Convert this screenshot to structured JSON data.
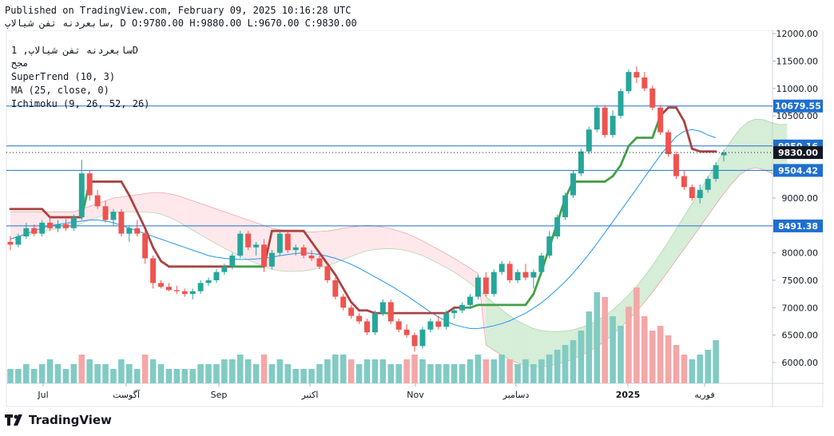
{
  "header": {
    "published": "Published on TradingView.com, February 09, 2025 10:16:28 UTC",
    "ohlc_line": "سابعردنه تفن شيالاپ, D O:9780.00 H:9880.00 L:9670.00 C:9830.00"
  },
  "legend": {
    "symbol": "سابعردنه تفن شيالاپ, 1D",
    "exchange": "مجح",
    "supertrend": "SuperTrend (10, 3)",
    "ma": "MA (25, close, 0)",
    "ichimoku": "Ichimoku (9, 26, 52, 26)"
  },
  "brand": {
    "name": "TradingView"
  },
  "colors": {
    "up": "#26a69a",
    "down": "#ef5350",
    "supertrend_up": "#43a047",
    "supertrend_down": "#a94442",
    "ma": "#2196f3",
    "hline": "#1e6fd0",
    "cloud_green": "#a5d6a7",
    "cloud_red": "#ffcdd2",
    "vol_up": "#80cbc4",
    "vol_down": "#f4a7a7",
    "current_price_bg": "#131722"
  },
  "chart_data": {
    "type": "candlestick",
    "ylim": [
      5620,
      12060
    ],
    "y_ticks": [
      "12000.00",
      "11500.00",
      "11000.00",
      "10500.00",
      "10000.00",
      "9500.00",
      "9000.00",
      "8500.00",
      "8000.00",
      "7500.00",
      "7000.00",
      "6500.00",
      "6000.00"
    ],
    "x_ticks": [
      "Jul",
      "آگوست",
      "Sep",
      "اکتبر",
      "Nov",
      "دسامبر",
      "2025",
      "فوریه"
    ],
    "horizontal_levels": [
      {
        "value": 10679.55,
        "label": "10679.55"
      },
      {
        "value": 9950.16,
        "label": "9950.16"
      },
      {
        "value": 9504.42,
        "label": "9504.42"
      },
      {
        "value": 8491.38,
        "label": "8491.38"
      }
    ],
    "current_price": {
      "value": 9830.0,
      "label": "9830.00"
    },
    "candles": [
      [
        8200,
        8300,
        8050,
        8150
      ],
      [
        8150,
        8350,
        8100,
        8300
      ],
      [
        8300,
        8550,
        8250,
        8450
      ],
      [
        8450,
        8520,
        8300,
        8350
      ],
      [
        8350,
        8600,
        8300,
        8550
      ],
      [
        8550,
        8650,
        8400,
        8450
      ],
      [
        8450,
        8600,
        8380,
        8520
      ],
      [
        8520,
        8620,
        8400,
        8450
      ],
      [
        8450,
        8700,
        8400,
        8650
      ],
      [
        8650,
        9700,
        8600,
        9450
      ],
      [
        9450,
        9500,
        8950,
        9050
      ],
      [
        9050,
        9150,
        8800,
        8850
      ],
      [
        8850,
        8950,
        8550,
        8600
      ],
      [
        8600,
        8800,
        8500,
        8750
      ],
      [
        8750,
        8800,
        8300,
        8350
      ],
      [
        8350,
        8500,
        8200,
        8450
      ],
      [
        8450,
        8600,
        8300,
        8350
      ],
      [
        8350,
        8400,
        7800,
        7900
      ],
      [
        7900,
        7950,
        7350,
        7450
      ],
      [
        7450,
        7500,
        7350,
        7380
      ],
      [
        7380,
        7450,
        7300,
        7320
      ],
      [
        7320,
        7400,
        7250,
        7300
      ],
      [
        7300,
        7350,
        7200,
        7250
      ],
      [
        7250,
        7350,
        7150,
        7300
      ],
      [
        7300,
        7500,
        7250,
        7450
      ],
      [
        7450,
        7550,
        7400,
        7500
      ],
      [
        7500,
        7700,
        7450,
        7650
      ],
      [
        7650,
        7800,
        7600,
        7750
      ],
      [
        7750,
        8000,
        7700,
        7950
      ],
      [
        7950,
        8400,
        7900,
        8350
      ],
      [
        8350,
        8400,
        8050,
        8100
      ],
      [
        8100,
        8200,
        7950,
        8150
      ],
      [
        8150,
        8250,
        7650,
        7750
      ],
      [
        7750,
        8050,
        7700,
        8000
      ],
      [
        8000,
        8400,
        7950,
        8350
      ],
      [
        8350,
        8400,
        8000,
        8050
      ],
      [
        8050,
        8150,
        7950,
        8100
      ],
      [
        8100,
        8150,
        7900,
        7950
      ],
      [
        7950,
        8050,
        7850,
        7900
      ],
      [
        7900,
        7950,
        7700,
        7750
      ],
      [
        7750,
        7800,
        7450,
        7500
      ],
      [
        7500,
        7550,
        7150,
        7200
      ],
      [
        7200,
        7250,
        6950,
        7000
      ],
      [
        7000,
        7050,
        6800,
        6850
      ],
      [
        6850,
        6900,
        6700,
        6750
      ],
      [
        6750,
        6800,
        6500,
        6550
      ],
      [
        6550,
        6950,
        6500,
        6900
      ],
      [
        6900,
        7150,
        6850,
        7100
      ],
      [
        7100,
        7150,
        6700,
        6750
      ],
      [
        6750,
        6800,
        6550,
        6600
      ],
      [
        6600,
        6700,
        6450,
        6500
      ],
      [
        6500,
        6550,
        6200,
        6300
      ],
      [
        6300,
        6650,
        6250,
        6600
      ],
      [
        6600,
        6800,
        6550,
        6750
      ],
      [
        6750,
        6850,
        6600,
        6650
      ],
      [
        6650,
        6950,
        6600,
        6900
      ],
      [
        6900,
        7000,
        6800,
        6950
      ],
      [
        6950,
        7100,
        6900,
        7050
      ],
      [
        7050,
        7250,
        7000,
        7200
      ],
      [
        7200,
        7600,
        7150,
        7550
      ],
      [
        7550,
        7650,
        7200,
        7250
      ],
      [
        7250,
        7700,
        7200,
        7650
      ],
      [
        7650,
        7850,
        7600,
        7800
      ],
      [
        7800,
        7850,
        7450,
        7500
      ],
      [
        7500,
        7700,
        7450,
        7650
      ],
      [
        7650,
        7800,
        7500,
        7550
      ],
      [
        7550,
        7700,
        7350,
        7650
      ],
      [
        7650,
        8000,
        7600,
        7950
      ],
      [
        7950,
        8400,
        7900,
        8300
      ],
      [
        8300,
        8700,
        8250,
        8650
      ],
      [
        8650,
        9100,
        8600,
        9050
      ],
      [
        9050,
        9500,
        9000,
        9450
      ],
      [
        9450,
        9900,
        9400,
        9850
      ],
      [
        9850,
        10300,
        9800,
        10250
      ],
      [
        10250,
        10700,
        10200,
        10650
      ],
      [
        10650,
        10700,
        10100,
        10150
      ],
      [
        10150,
        10600,
        10100,
        10500
      ],
      [
        10500,
        11000,
        10450,
        10950
      ],
      [
        10950,
        11350,
        10900,
        11300
      ],
      [
        11300,
        11400,
        11100,
        11200
      ],
      [
        11200,
        11300,
        10950,
        11000
      ],
      [
        11000,
        11050,
        10600,
        10650
      ],
      [
        10650,
        10700,
        10150,
        10200
      ],
      [
        10200,
        10250,
        9750,
        9800
      ],
      [
        9800,
        9850,
        9350,
        9400
      ],
      [
        9400,
        9500,
        9150,
        9200
      ],
      [
        9200,
        9250,
        8950,
        9000
      ],
      [
        9000,
        9250,
        8900,
        9150
      ],
      [
        9150,
        9400,
        9100,
        9350
      ],
      [
        9350,
        9650,
        9300,
        9600
      ],
      [
        9780,
        9880,
        9670,
        9830
      ]
    ],
    "supertrend": [
      8800,
      8800,
      8800,
      8800,
      8800,
      8650,
      8650,
      8650,
      8650,
      8650,
      9300,
      9300,
      9300,
      9300,
      9300,
      9050,
      8750,
      8450,
      8100,
      7850,
      7750,
      7750,
      7750,
      7750,
      7750,
      7750,
      7750,
      7750,
      7750,
      7750,
      7750,
      7750,
      7750,
      8400,
      8400,
      8400,
      8400,
      8400,
      8200,
      8000,
      7800,
      7600,
      7350,
      7100,
      6950,
      6950,
      6900,
      6900,
      6900,
      6900,
      6900,
      6900,
      6900,
      6900,
      6900,
      6900,
      7000,
      7000,
      7000,
      7050,
      7050,
      7050,
      7050,
      7050,
      7050,
      7050,
      7250,
      7650,
      8100,
      8550,
      9000,
      9300,
      9300,
      9300,
      9300,
      9300,
      9400,
      9600,
      9950,
      10100,
      10100,
      10100,
      10500,
      10650,
      10650,
      10400,
      9900,
      9850,
      9850,
      9850
    ],
    "ma": [
      8250,
      8300,
      8350,
      8400,
      8450,
      8500,
      8520,
      8540,
      8560,
      8580,
      8600,
      8600,
      8580,
      8550,
      8500,
      8450,
      8400,
      8350,
      8300,
      8250,
      8200,
      8150,
      8100,
      8050,
      8000,
      7950,
      7920,
      7900,
      7890,
      7880,
      7880,
      7890,
      7900,
      7920,
      7950,
      7970,
      7990,
      8000,
      7990,
      7970,
      7940,
      7900,
      7850,
      7790,
      7720,
      7640,
      7560,
      7480,
      7400,
      7310,
      7220,
      7120,
      7020,
      6920,
      6830,
      6750,
      6690,
      6650,
      6620,
      6620,
      6640,
      6670,
      6710,
      6760,
      6830,
      6900,
      6990,
      7090,
      7210,
      7340,
      7480,
      7630,
      7800,
      7980,
      8170,
      8370,
      8570,
      8770,
      8970,
      9170,
      9380,
      9580,
      9780,
      9960,
      10120,
      10220,
      10250,
      10220,
      10150,
      10100
    ],
    "volume": [
      3,
      3,
      4,
      3,
      4,
      5,
      4,
      3,
      4,
      6,
      5,
      4,
      4,
      3,
      5,
      4,
      3,
      6,
      5,
      4,
      3,
      3,
      3,
      3,
      4,
      4,
      4,
      5,
      5,
      6,
      5,
      4,
      6,
      4,
      5,
      4,
      3,
      3,
      3,
      4,
      5,
      6,
      6,
      5,
      4,
      5,
      5,
      5,
      4,
      4,
      5,
      6,
      5,
      4,
      4,
      4,
      4,
      4,
      5,
      6,
      5,
      5,
      6,
      5,
      4,
      5,
      4,
      5,
      6,
      7,
      8,
      9,
      11,
      15,
      19,
      18,
      14,
      12,
      16,
      20,
      14,
      11,
      12,
      10,
      8,
      6,
      5,
      6,
      7,
      9
    ],
    "vol_colors_red": [
      9,
      17,
      32,
      43,
      50,
      51,
      60,
      63,
      75,
      78,
      79,
      80,
      81,
      82,
      83,
      84,
      85
    ]
  }
}
